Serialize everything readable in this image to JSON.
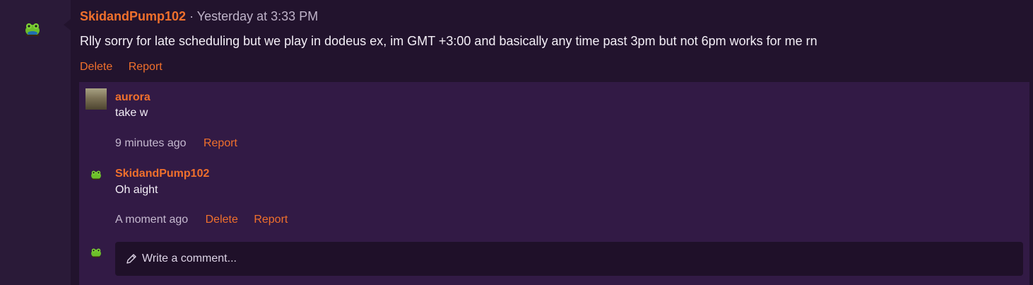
{
  "post": {
    "username": "SkidandPump102",
    "separator": "·",
    "timestamp": "Yesterday at 3:33 PM",
    "body": "Rlly sorry for late scheduling but we play in dodeus ex, im GMT +3:00 and basically any time past 3pm but not 6pm works for me rn",
    "actions": {
      "delete": "Delete",
      "report": "Report"
    }
  },
  "comments": [
    {
      "username": "aurora",
      "text": "take w",
      "time": "9 minutes ago",
      "report": "Report"
    },
    {
      "username": "SkidandPump102",
      "text": "Oh aight",
      "time": "A moment ago",
      "delete": "Delete",
      "report": "Report"
    }
  ],
  "composer": {
    "placeholder": "Write a comment..."
  },
  "colors": {
    "accent": "#f0702c",
    "background": "#22132d",
    "comments_bg": "#321a45"
  }
}
